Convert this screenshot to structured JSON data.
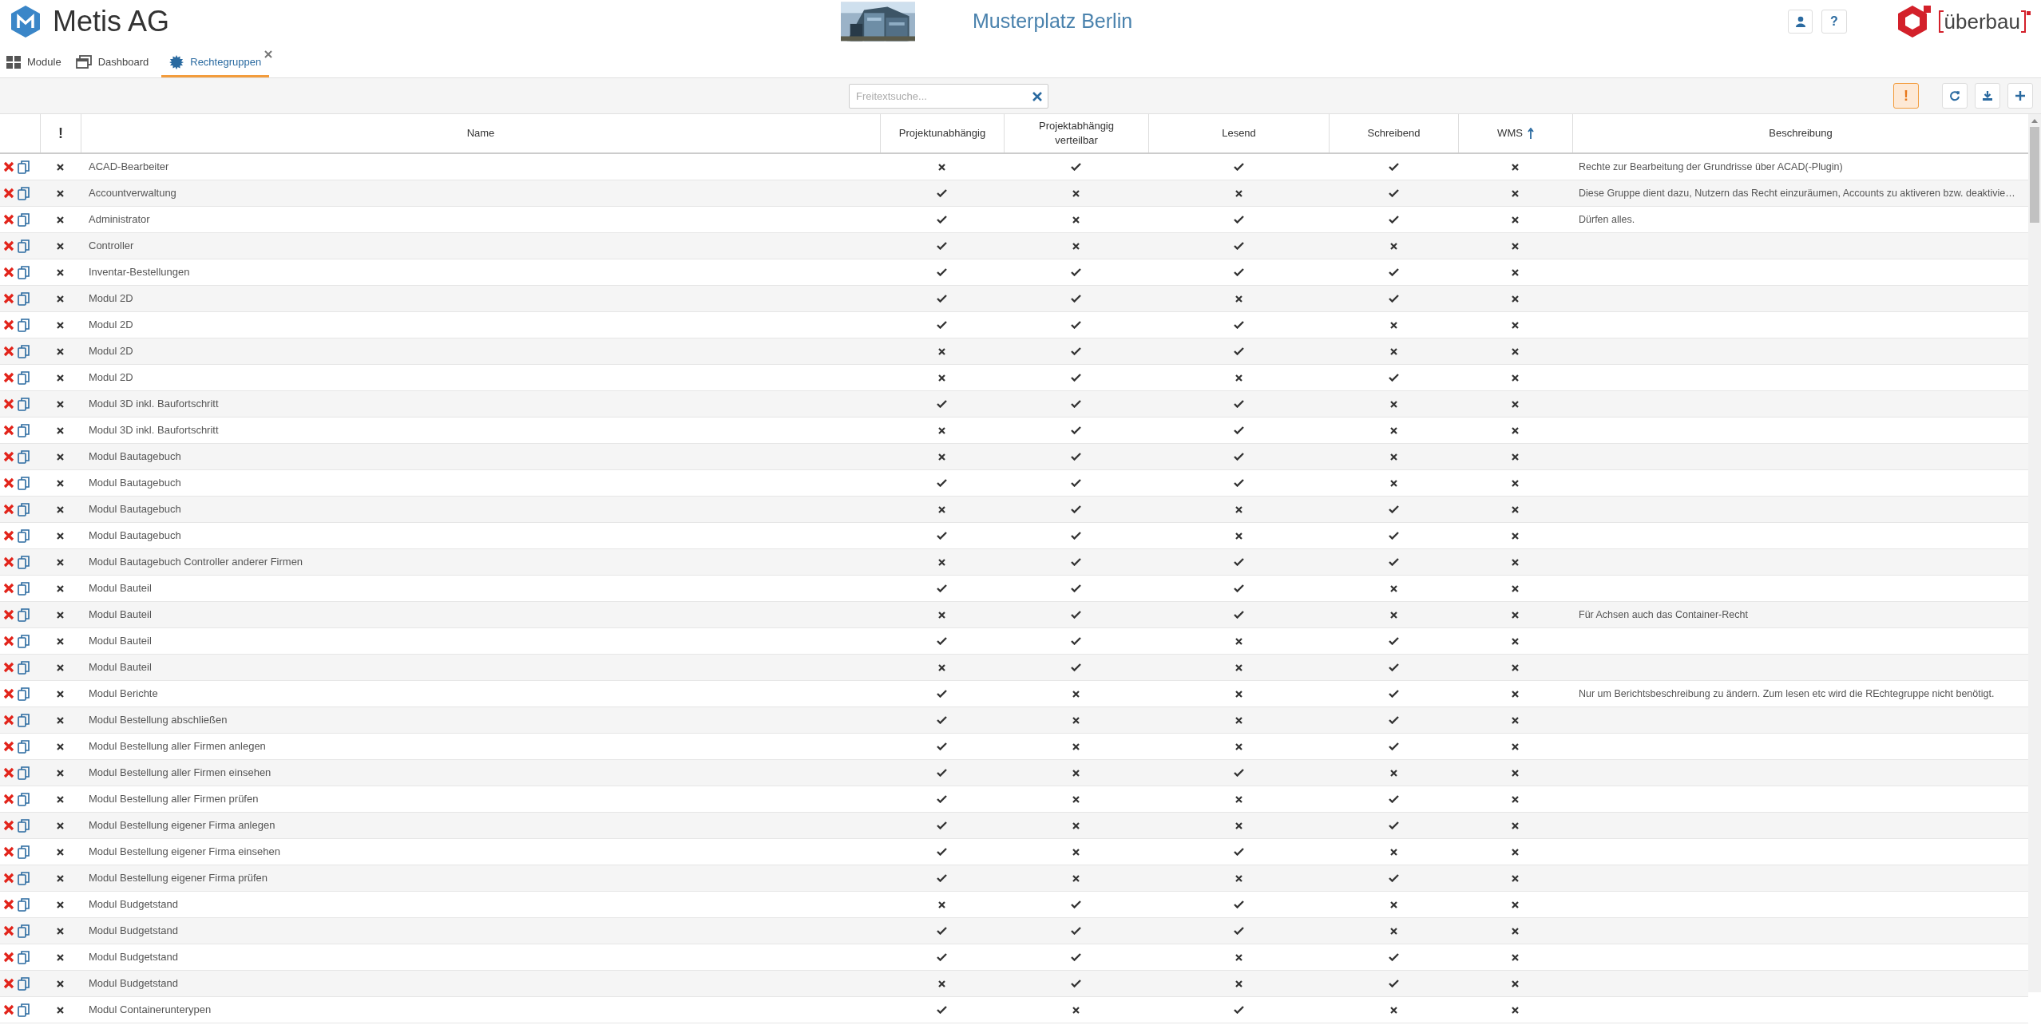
{
  "header": {
    "title": "Metis AG",
    "location": "Musterplatz Berlin",
    "help_button": "?",
    "brand": "überbau"
  },
  "tabs": [
    {
      "label": "Module",
      "kind": "modules",
      "selected": false,
      "closable": false
    },
    {
      "label": "Dashboard",
      "kind": "dashboard",
      "selected": false,
      "closable": false
    },
    {
      "label": "Rechtegruppen",
      "kind": "gear",
      "selected": true,
      "closable": true
    }
  ],
  "toolbar": {
    "search": {
      "placeholder": "Freitextsuche..."
    },
    "alert_button": "!"
  },
  "table": {
    "columns": [
      {
        "label": "!",
        "sorted": false
      },
      {
        "label": "Name",
        "sorted": false
      },
      {
        "label": "Projektunabhängig",
        "sorted": false
      },
      {
        "label": "Projektabhängig verteilbar",
        "sorted": false
      },
      {
        "label": "Lesend",
        "sorted": false
      },
      {
        "label": "Schreibend",
        "sorted": false
      },
      {
        "label": "WMS",
        "sorted": true
      },
      {
        "label": "Beschreibung",
        "sorted": false
      }
    ],
    "rows": [
      {
        "name": "ACAD-Bearbeiter",
        "warning": false,
        "values": [
          false,
          true,
          true,
          true,
          false
        ],
        "description": "Rechte zur Bearbeitung der Grundrisse über ACAD(-Plugin)"
      },
      {
        "name": "Accountverwaltung",
        "warning": false,
        "values": [
          true,
          false,
          false,
          true,
          false
        ],
        "description": "Diese Gruppe dient dazu, Nutzern das Recht einzuräumen, Accounts zu aktiveren bzw. deaktivie…"
      },
      {
        "name": "Administrator",
        "warning": false,
        "values": [
          true,
          false,
          true,
          true,
          false
        ],
        "description": "Dürfen alles."
      },
      {
        "name": "Controller",
        "warning": false,
        "values": [
          true,
          false,
          true,
          false,
          false
        ]
      },
      {
        "name": "Inventar-Bestellungen",
        "warning": false,
        "values": [
          true,
          true,
          true,
          true,
          false
        ]
      },
      {
        "name": "Modul 2D",
        "warning": false,
        "values": [
          true,
          true,
          false,
          true,
          false
        ]
      },
      {
        "name": "Modul 2D",
        "warning": false,
        "values": [
          true,
          true,
          true,
          false,
          false
        ]
      },
      {
        "name": "Modul 2D",
        "warning": false,
        "values": [
          false,
          true,
          true,
          false,
          false
        ]
      },
      {
        "name": "Modul 2D",
        "warning": false,
        "values": [
          false,
          true,
          false,
          true,
          false
        ]
      },
      {
        "name": "Modul 3D inkl. Baufortschritt",
        "warning": false,
        "values": [
          true,
          true,
          true,
          false,
          false
        ]
      },
      {
        "name": "Modul 3D inkl. Baufortschritt",
        "warning": false,
        "values": [
          false,
          true,
          true,
          false,
          false
        ]
      },
      {
        "name": "Modul Bautagebuch",
        "warning": false,
        "values": [
          false,
          true,
          true,
          false,
          false
        ]
      },
      {
        "name": "Modul Bautagebuch",
        "warning": false,
        "values": [
          true,
          true,
          true,
          false,
          false
        ]
      },
      {
        "name": "Modul Bautagebuch",
        "warning": false,
        "values": [
          false,
          true,
          false,
          true,
          false
        ]
      },
      {
        "name": "Modul Bautagebuch",
        "warning": false,
        "values": [
          true,
          true,
          false,
          true,
          false
        ]
      },
      {
        "name": "Modul Bautagebuch Controller anderer Firmen",
        "warning": false,
        "values": [
          false,
          true,
          true,
          true,
          false
        ]
      },
      {
        "name": "Modul Bauteil",
        "warning": false,
        "values": [
          true,
          true,
          true,
          false,
          false
        ]
      },
      {
        "name": "Modul Bauteil",
        "warning": false,
        "values": [
          false,
          true,
          true,
          false,
          false
        ],
        "description": "Für Achsen auch das Container-Recht"
      },
      {
        "name": "Modul Bauteil",
        "warning": false,
        "values": [
          true,
          true,
          false,
          true,
          false
        ]
      },
      {
        "name": "Modul Bauteil",
        "warning": false,
        "values": [
          false,
          true,
          false,
          true,
          false
        ]
      },
      {
        "name": "Modul Berichte",
        "warning": false,
        "values": [
          true,
          false,
          false,
          true,
          false
        ],
        "description": "Nur um Berichtsbeschreibung zu ändern. Zum lesen etc wird die REchtegruppe nicht benötigt."
      },
      {
        "name": "Modul Bestellung abschließen",
        "warning": false,
        "values": [
          true,
          false,
          false,
          true,
          false
        ]
      },
      {
        "name": "Modul Bestellung aller Firmen anlegen",
        "warning": false,
        "values": [
          true,
          false,
          false,
          true,
          false
        ]
      },
      {
        "name": "Modul Bestellung aller Firmen einsehen",
        "warning": false,
        "values": [
          true,
          false,
          true,
          false,
          false
        ]
      },
      {
        "name": "Modul Bestellung aller Firmen prüfen",
        "warning": false,
        "values": [
          true,
          false,
          false,
          true,
          false
        ]
      },
      {
        "name": "Modul Bestellung eigener Firma anlegen",
        "warning": false,
        "values": [
          true,
          false,
          false,
          true,
          false
        ]
      },
      {
        "name": "Modul Bestellung eigener Firma einsehen",
        "warning": false,
        "values": [
          true,
          false,
          true,
          false,
          false
        ]
      },
      {
        "name": "Modul Bestellung eigener Firma prüfen",
        "warning": false,
        "values": [
          true,
          false,
          false,
          true,
          false
        ]
      },
      {
        "name": "Modul Budgetstand",
        "warning": false,
        "values": [
          false,
          true,
          true,
          false,
          false
        ]
      },
      {
        "name": "Modul Budgetstand",
        "warning": false,
        "values": [
          true,
          true,
          true,
          false,
          false
        ]
      },
      {
        "name": "Modul Budgetstand",
        "warning": false,
        "values": [
          true,
          true,
          false,
          true,
          false
        ]
      },
      {
        "name": "Modul Budgetstand",
        "warning": false,
        "values": [
          false,
          true,
          false,
          true,
          false
        ]
      },
      {
        "name": "Modul Containerunterypen",
        "warning": false,
        "values": [
          true,
          false,
          true,
          false,
          false
        ]
      }
    ]
  }
}
